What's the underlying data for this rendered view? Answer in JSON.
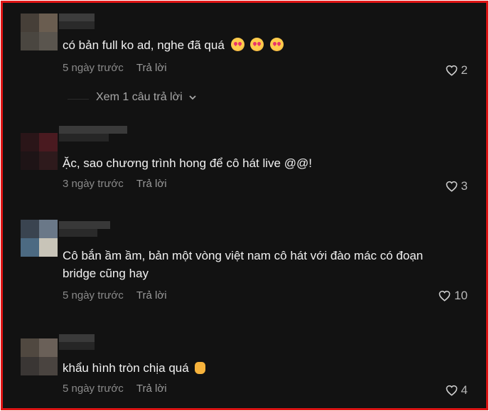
{
  "comments": [
    {
      "text": "có bản full ko ad, nghe đã quá",
      "emojis": [
        "smiling-face-with-hearts",
        "smiling-face-with-hearts",
        "smiling-face-with-hearts"
      ],
      "time": "5 ngày trước",
      "reply": "Trả lời",
      "likes": "2",
      "avatar_colors": [
        "#463f38",
        "#6a5d50",
        "#4a4640",
        "#5a554e"
      ],
      "username_colors": [
        "#3c3c3c",
        "#2a2a2a"
      ]
    },
    {
      "text": "Ặc, sao chương trình hong để cô hát live @@!",
      "time": "3 ngày trước",
      "reply": "Trả lời",
      "likes": "3",
      "avatar_colors": [
        "#2a1518",
        "#4a1a20",
        "#1e1416",
        "#2e1a1c"
      ],
      "username_colors": [
        "#3a3a3a",
        "#262626"
      ]
    },
    {
      "text": "Cô bắn ầm ầm, bản một vòng việt nam cô hát với đào mác có đoạn bridge cũng hay",
      "time": "5 ngày trước",
      "reply": "Trả lời",
      "likes": "10",
      "avatar_colors": [
        "#3a4450",
        "#6a7888",
        "#4c6a82",
        "#c8c4b8"
      ],
      "username_colors": [
        "#383838",
        "#2a2a2a"
      ]
    },
    {
      "text": "khẩu hình tròn chịa quá",
      "emojis": [
        "thumbs-up"
      ],
      "time": "5 ngày trước",
      "reply": "Trả lời",
      "likes": "4",
      "avatar_colors": [
        "#504840",
        "#6a6058",
        "#3a3634",
        "#4a4440"
      ],
      "username_colors": [
        "#3a3a3a",
        "#262626"
      ]
    }
  ],
  "view_replies": {
    "label": "Xem 1 câu trả lời"
  },
  "colors": {
    "border": "#e01616",
    "background": "#121212",
    "text": "#f1f1f1",
    "muted": "#8a8a8a"
  }
}
